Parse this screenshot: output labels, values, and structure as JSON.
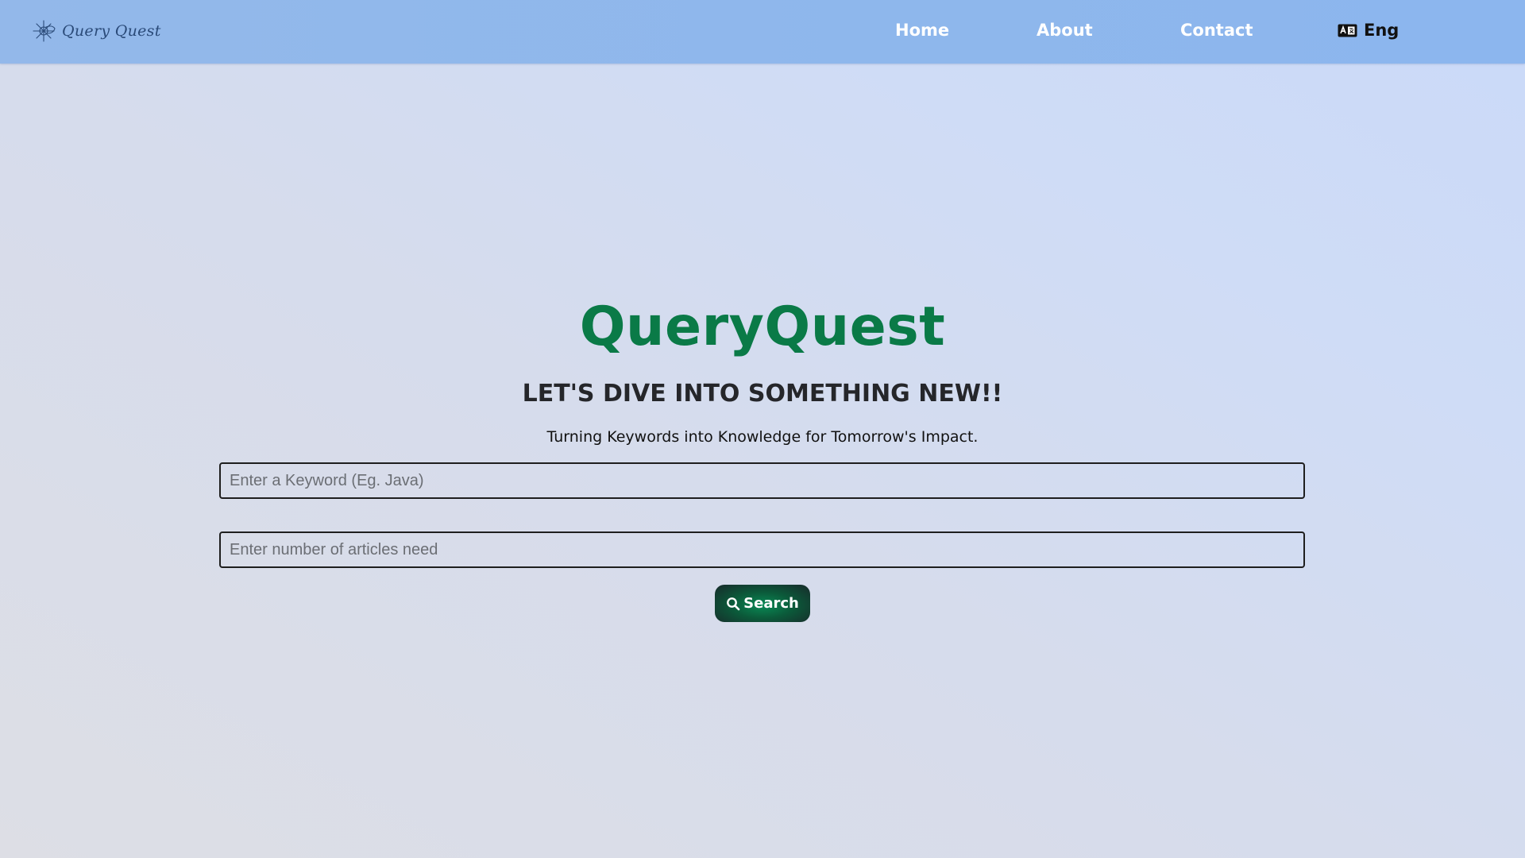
{
  "navbar": {
    "logo_text": "Query Quest",
    "logo_icon": "compass-sparkle-icon",
    "links": {
      "home": "Home",
      "about": "About",
      "contact": "Contact"
    },
    "language": {
      "label": "Eng",
      "icon": "language-icon"
    }
  },
  "hero": {
    "title": "QueryQuest",
    "subtitle": "LET'S DIVE INTO SOMETHING NEW!!",
    "tagline": "Turning Keywords into Knowledge for Tomorrow's Impact."
  },
  "form": {
    "keyword_placeholder": "Enter a Keyword (Eg. Java)",
    "keyword_value": "",
    "count_placeholder": "Enter number of articles need",
    "count_value": "",
    "search_label": "Search",
    "search_icon": "search-icon"
  },
  "colors": {
    "navbar": "#8eb7ec",
    "title_green": "#0a7a47",
    "button_green": "#0a8a55",
    "button_dark": "#18292a"
  }
}
